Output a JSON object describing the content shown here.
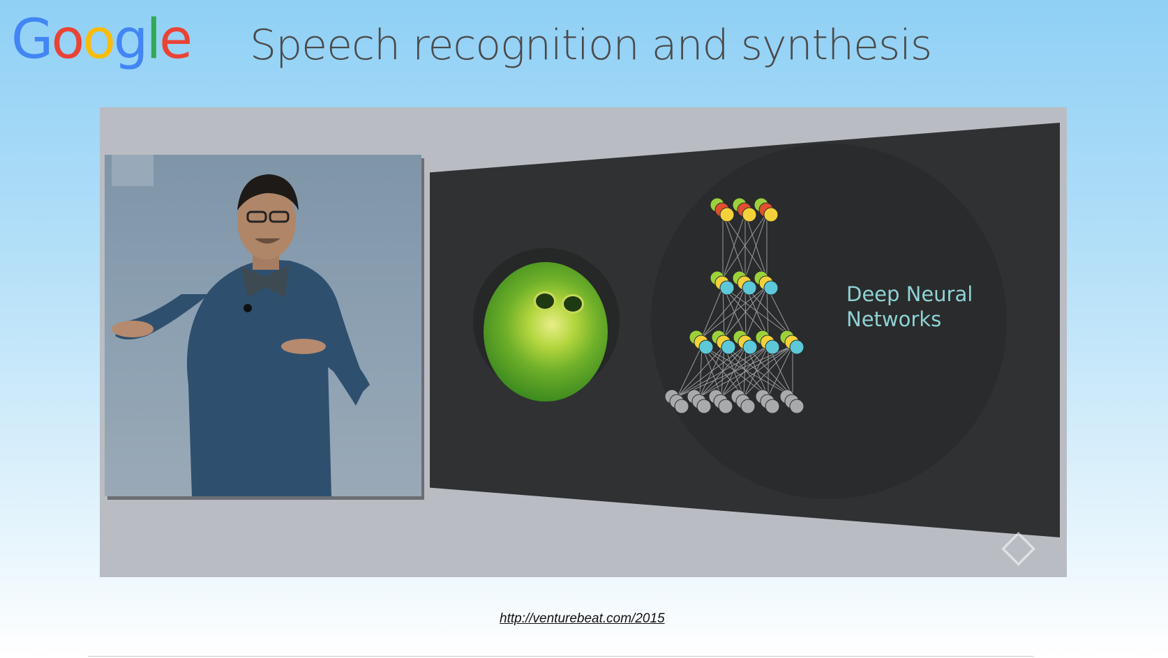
{
  "logo": {
    "letters": [
      {
        "ch": "G",
        "color": "#4285F4"
      },
      {
        "ch": "o",
        "color": "#EA4335"
      },
      {
        "ch": "o",
        "color": "#FBBC05"
      },
      {
        "ch": "g",
        "color": "#4285F4"
      },
      {
        "ch": "l",
        "color": "#34A853"
      },
      {
        "ch": "e",
        "color": "#EA4335"
      }
    ]
  },
  "slide": {
    "title": "Speech recognition and synthesis"
  },
  "photo": {
    "screen_label": "Deep Neural\nNetworks",
    "watermark_icon": "io-diamond-icon"
  },
  "footer": {
    "link": "http://venturebeat.com/2015"
  },
  "colors": {
    "node_green": "#9bd23a",
    "node_red": "#e0502e",
    "node_yellow": "#f3d13a",
    "node_cyan": "#5cc8d8",
    "node_gray": "#a9aaab",
    "edge": "#9a9b9c"
  }
}
